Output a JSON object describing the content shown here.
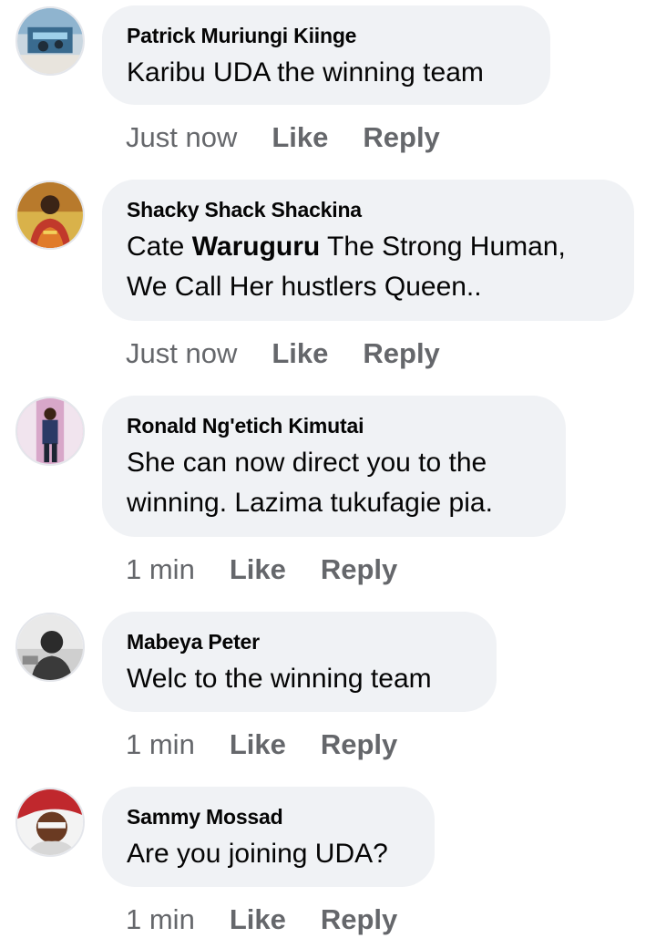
{
  "comments": [
    {
      "author": "Patrick Muriungi Kiinge",
      "text": "Karibu UDA the winning team",
      "time": "Just now",
      "like": "Like",
      "reply": "Reply"
    },
    {
      "author": "Shacky Shack Shackina",
      "text_prefix": "Cate ",
      "text_tag": "Waruguru",
      "text_line1_rest": " The Strong Human,",
      "text_line2": "We Call Her hustlers Queen..",
      "time": "Just now",
      "like": "Like",
      "reply": "Reply"
    },
    {
      "author": "Ronald Ng'etich Kimutai",
      "text_line1": "She can now direct you to the",
      "text_line2": "winning. Lazima tukufagie pia.",
      "time": "1 min",
      "like": "Like",
      "reply": "Reply"
    },
    {
      "author": "Mabeya Peter",
      "text": "Welc to the winning team",
      "time": "1 min",
      "like": "Like",
      "reply": "Reply"
    },
    {
      "author": "Sammy Mossad",
      "text": "Are you joining UDA?",
      "time": "1 min",
      "like": "Like",
      "reply": "Reply"
    }
  ],
  "colors": {
    "bubble": "#f0f2f5",
    "text": "#050505",
    "meta": "#65676b"
  }
}
